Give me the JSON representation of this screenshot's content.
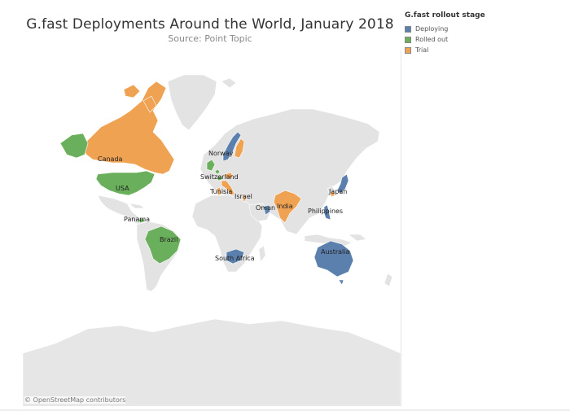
{
  "title": "G.fast Deployments Around the World, January 2018",
  "subtitle": "Source: Point Topic",
  "legend": {
    "title": "G.fast rollout stage",
    "items": [
      {
        "label": "Deploying",
        "color": "#5b80ad"
      },
      {
        "label": "Rolled out",
        "color": "#6aaf5b"
      },
      {
        "label": "Trial",
        "color": "#f0a253"
      }
    ]
  },
  "attribution": "© OpenStreetMap contributors",
  "map": {
    "labels": {
      "canada": "Canada",
      "usa": "USA",
      "panama": "Panama",
      "brazil": "Brazil",
      "norway": "Norway",
      "switzerland": "Switzerland",
      "tunisia": "Tunisia",
      "israel": "Israel",
      "oman": "Oman",
      "india": "India",
      "japan": "Japan",
      "philippines": "Philippines",
      "south_africa": "South Africa",
      "australia": "Australia"
    },
    "stages": {
      "Canada": "Trial",
      "USA": "Rolled out",
      "Alaska": "Rolled out",
      "Panama": "Rolled out",
      "Brazil": "Rolled out",
      "Norway": "Deploying",
      "Finland": "Trial",
      "United Kingdom": "Rolled out",
      "Belgium": "Rolled out",
      "Switzerland": "Rolled out",
      "Austria": "Trial",
      "Italy": "Trial",
      "Tunisia": "Trial",
      "Israel": "Trial",
      "Oman": "Deploying",
      "India": "Trial",
      "Japan": "Deploying",
      "Taiwan": "Trial",
      "Philippines": "Deploying",
      "South Africa": "Deploying",
      "Australia": "Deploying"
    }
  }
}
